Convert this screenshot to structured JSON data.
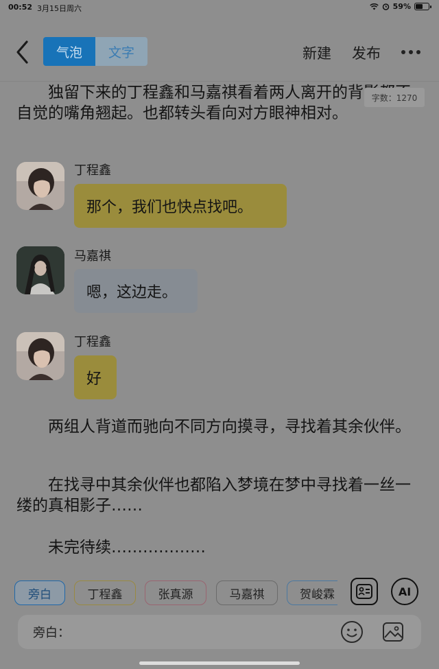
{
  "status_bar": {
    "time": "00:52",
    "date": "3月15日周六",
    "battery": "59%",
    "battery_level": 0.59
  },
  "header": {
    "tabs": [
      {
        "label": "气泡",
        "active": true
      },
      {
        "label": "文字",
        "active": false
      }
    ],
    "new_label": "新建",
    "publish_label": "发布"
  },
  "word_count": "字数：1270",
  "paragraphs": {
    "p1": "独留下来的丁程鑫和马嘉祺看着两人离开的背影都不自觉的嘴角翘起。也都转头看向对方眼神相对。",
    "p2": "两组人背道而驰向不同方向摸寻，寻找着其余伙伴。",
    "p3": "在找寻中其余伙伴也都陷入梦境在梦中寻找着一丝一缕的真相影子……",
    "p4": "未完待续………………"
  },
  "messages": [
    {
      "speaker": "丁程鑫",
      "text": "那个，我们也快点找吧。",
      "color": "#9a8c3c"
    },
    {
      "speaker": "马嘉祺",
      "text": "嗯，这边走。",
      "color": "#868c93"
    },
    {
      "speaker": "丁程鑫",
      "text": "好",
      "color": "#9a8c3c"
    }
  ],
  "tags": [
    {
      "label": "旁白",
      "color": "#1f67a8"
    },
    {
      "label": "丁程鑫",
      "color": "#9a8a40"
    },
    {
      "label": "张真源",
      "color": "#9a6470"
    },
    {
      "label": "马嘉祺",
      "color": "#6a6a6a"
    },
    {
      "label": "贺峻霖",
      "color": "#4a78a0"
    }
  ],
  "ai_label": "AI",
  "input": {
    "label": "旁白："
  }
}
